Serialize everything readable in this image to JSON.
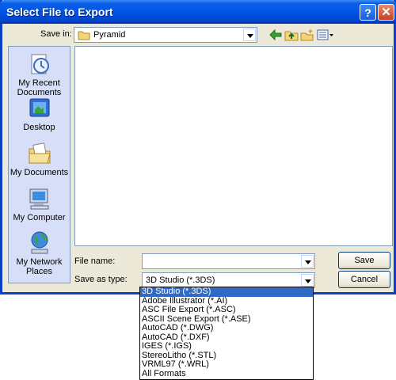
{
  "window": {
    "title": "Select File to Export",
    "help_label": "?",
    "close_label": "✕"
  },
  "save_in": {
    "label": "Save in:",
    "value": "Pyramid"
  },
  "toolbar": {
    "icons": [
      "back-arrow-icon",
      "up-folder-icon",
      "new-folder-icon",
      "views-menu-icon"
    ]
  },
  "places": [
    {
      "label_line1": "My Recent",
      "label_line2": "Documents",
      "icon": "recent-documents-icon"
    },
    {
      "label_line1": "Desktop",
      "label_line2": "",
      "icon": "desktop-icon"
    },
    {
      "label_line1": "My Documents",
      "label_line2": "",
      "icon": "my-documents-icon"
    },
    {
      "label_line1": "My Computer",
      "label_line2": "",
      "icon": "my-computer-icon"
    },
    {
      "label_line1": "My Network",
      "label_line2": "Places",
      "icon": "network-places-icon"
    }
  ],
  "file_name": {
    "label": "File name:",
    "value": ""
  },
  "save_as_type": {
    "label": "Save as type:",
    "value": "3D Studio (*.3DS)",
    "options": [
      "3D Studio (*.3DS)",
      "Adobe Illustrator (*.AI)",
      "ASC File Export (*.ASC)",
      "ASCII Scene Export (*.ASE)",
      "AutoCAD (*.DWG)",
      "AutoCAD (*.DXF)",
      "IGES (*.IGS)",
      "StereoLitho (*.STL)",
      "VRML97 (*.WRL)",
      "All Formats"
    ],
    "selected_index": 0
  },
  "buttons": {
    "save": "Save",
    "cancel": "Cancel"
  },
  "colors": {
    "titlebar": "#0055e5",
    "selection": "#316ac5",
    "dialog_bg": "#ece9d8",
    "places_bg": "#d6dff7"
  }
}
